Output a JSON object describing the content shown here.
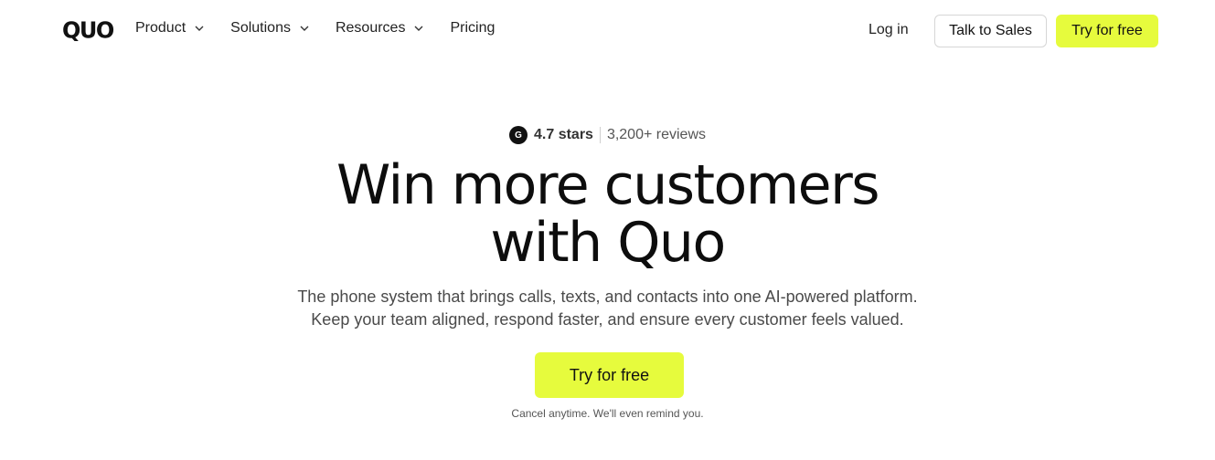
{
  "brand": {
    "logo": "QUO"
  },
  "nav": {
    "items": [
      {
        "label": "Product",
        "dropdown": true
      },
      {
        "label": "Solutions",
        "dropdown": true
      },
      {
        "label": "Resources",
        "dropdown": true
      },
      {
        "label": "Pricing",
        "dropdown": false
      }
    ],
    "login": "Log in",
    "talk_to_sales": "Talk to Sales",
    "try_free": "Try for free"
  },
  "hero": {
    "rating_icon": "G2-logo-icon",
    "rating_badge": "G",
    "stars": "4.7 stars",
    "reviews": "3,200+ reviews",
    "headline_line1": "Win more customers",
    "headline_line2": "with Quo",
    "sub_line1": "The phone system that brings calls, texts, and contacts into one AI-powered platform.",
    "sub_line2": "Keep your team aligned, respond faster, and ensure every customer feels valued.",
    "cta": "Try for free",
    "cancel_note": "Cancel anytime. We'll even remind you."
  },
  "colors": {
    "accent": "#e6fb3d",
    "text": "#1a1a1a",
    "muted": "#4a4a4a"
  }
}
